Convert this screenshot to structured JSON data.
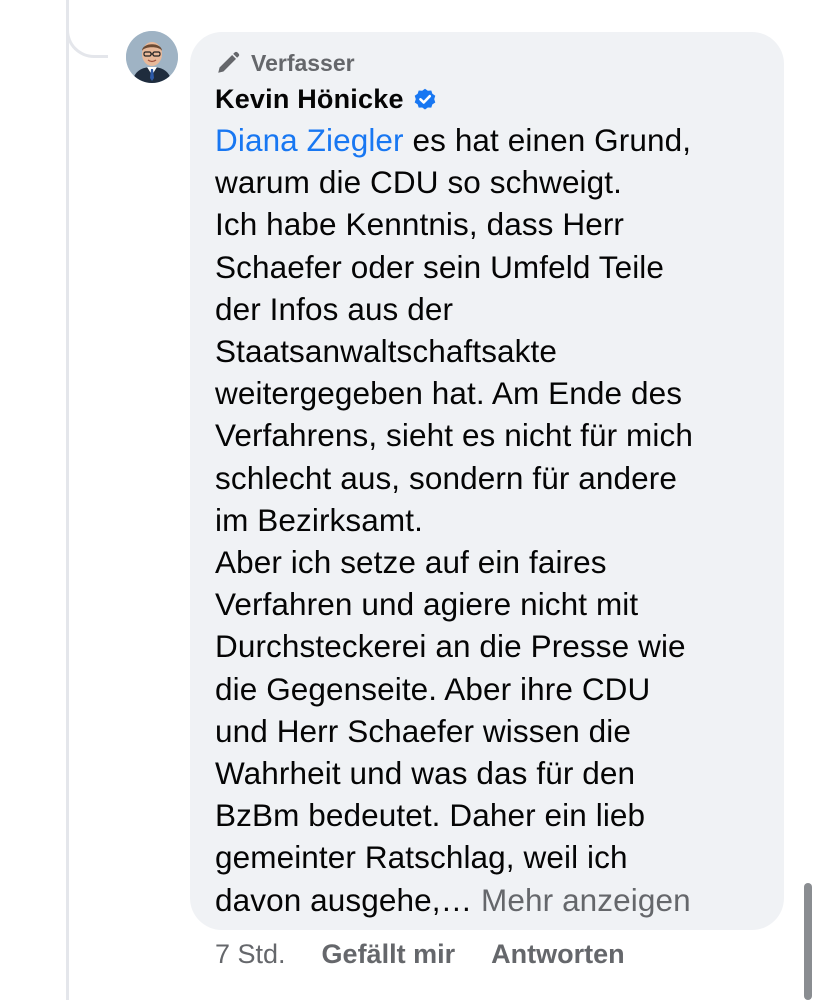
{
  "comment": {
    "author_badge": "Verfasser",
    "author_name": "Kevin Hönicke",
    "mention": "Diana Ziegler",
    "body_text": " es hat einen Grund,\nwarum die CDU so schweigt.\nIch habe Kenntnis, dass Herr\nSchaefer oder sein Umfeld Teile\nder Infos aus der\nStaatsanwaltschaftsakte\nweitergegeben hat. Am Ende des\nVerfahrens, sieht es nicht für mich\nschlecht aus, sondern für andere\nim Bezirksamt.\nAber ich setze auf ein faires\nVerfahren und agiere nicht mit\nDurchsteckerei an die Presse wie\ndie Gegenseite. Aber ihre CDU\nund Herr Schaefer wissen die\nWahrheit und was das für den\nBzBm bedeutet. Daher ein lieb\ngemeinter Ratschlag, weil ich\ndavon ausgehe,… ",
    "see_more": "Mehr anzeigen",
    "timestamp": "7 Std.",
    "like_label": "Gefällt mir",
    "reply_label": "Antworten"
  },
  "icons": {
    "badge": "pencil-icon",
    "verified": "verified-badge-icon"
  },
  "colors": {
    "mention": "#1877f2",
    "bubble_background": "#f0f2f5",
    "secondary_text": "#65676b",
    "primary_text": "#050505"
  }
}
